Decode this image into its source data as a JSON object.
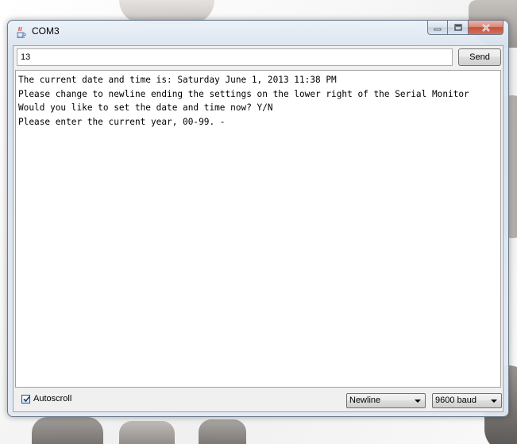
{
  "window": {
    "title": "COM3",
    "icon": "java-coffee-cup-icon"
  },
  "controls": {
    "minimize_icon": "minimize-icon",
    "maximize_icon": "maximize-icon",
    "close_icon": "close-icon"
  },
  "input": {
    "value": "13"
  },
  "send_label": "Send",
  "output": {
    "lines": [
      "The current date and time is: Saturday June 1, 2013 11:38 PM",
      "Please change to newline ending the settings on the lower right of the Serial Monitor",
      "Would you like to set the date and time now? Y/N",
      "Please enter the current year, 00-99. -"
    ]
  },
  "footer": {
    "autoscroll_label": "Autoscroll",
    "autoscroll_checked": true,
    "line_ending": "Newline",
    "baud_rate": "9600 baud"
  },
  "colors": {
    "close_button": "#c6503b",
    "window_frame": "#d6e0ec"
  }
}
